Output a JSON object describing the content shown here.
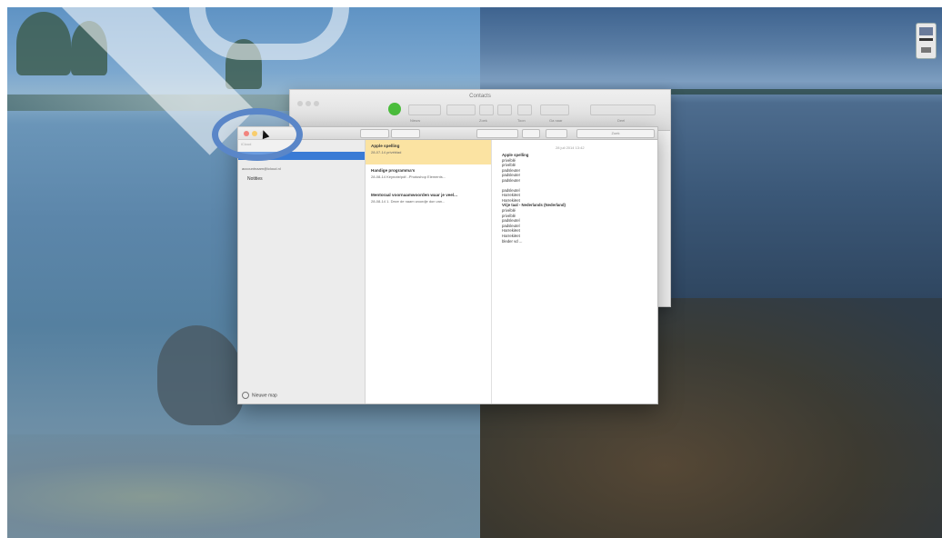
{
  "back_window": {
    "title": "Contacts",
    "toolbar_labels": [
      "Nieuw",
      "Zoek",
      "Toon",
      "Ga naar",
      "Deel"
    ]
  },
  "notes": {
    "sidebar": {
      "header": "iCloud",
      "account": "accountnaam@icloud.nl",
      "folder": "Notities",
      "new_folder": "Nieuwe map"
    },
    "search_placeholder": "Zoek",
    "list": [
      {
        "title": "Apple spelling",
        "subtitle": "28-07-14  privéblad"
      },
      {
        "title": "Handige programma's",
        "subtitle": "28-08-14  Keynote/pdf...Photoshop Elements..."
      },
      {
        "title": "Mentoraal voornaamwoorden waar je veel...",
        "subtitle": "28-08-14  1. Deze de naam woordje don van..."
      }
    ],
    "editor": {
      "date": "28 juli 2014 13:42",
      "lines": [
        "Apple spelling",
        "privéblé",
        "privéblé",
        "padsleuter",
        "padsleuter",
        "padsleuter",
        "",
        "padsleutel",
        "Harrekiëet",
        "Harrekiëet",
        "Vrije taal - Nederlands (Nederland)",
        "privéblé",
        "privéblé",
        "padsleutel",
        "padsleutel",
        "Harrekiëet",
        "Harrekiëet",
        "bleder vd ..."
      ]
    }
  },
  "colors": {
    "accent": "#3a7bd5",
    "selected_note": "#fbe3a2",
    "highlight_ring": "#5a86c8",
    "close": "#ee5b52",
    "minimize": "#f6bd3d"
  }
}
